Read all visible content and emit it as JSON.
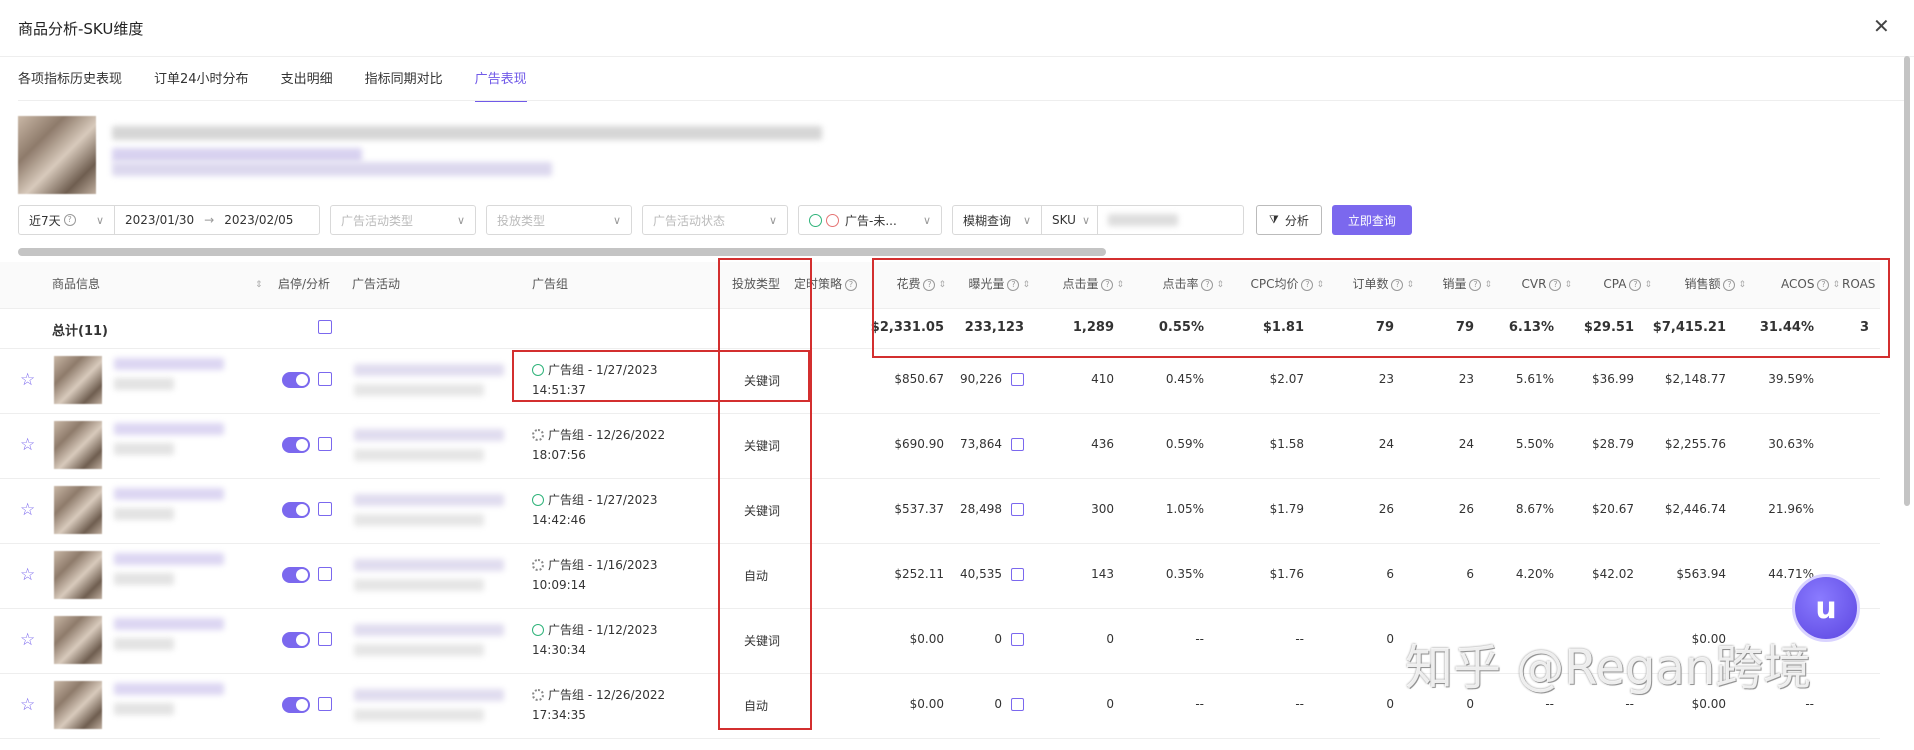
{
  "window": {
    "title": "商品分析-SKU维度",
    "close": "✕"
  },
  "tabs": [
    {
      "label": "各项指标历史表现"
    },
    {
      "label": "订单24小时分布"
    },
    {
      "label": "支出明细"
    },
    {
      "label": "指标同期对比"
    },
    {
      "label": "广告表现",
      "active": true
    }
  ],
  "filters": {
    "range_label": "近7天",
    "date_start": "2023/01/30",
    "date_arrow": "→",
    "date_end": "2023/02/05",
    "campaign_type_placeholder": "广告活动类型",
    "targeting_type_placeholder": "投放类型",
    "campaign_status_placeholder": "广告活动状态",
    "ad_status_value": "广告-未...",
    "fuzzy_query": "模糊查询",
    "sku_label": "SKU",
    "analyze_button": "分析",
    "query_button": "立即查询"
  },
  "columns": {
    "product": "商品信息",
    "toggle": "启停/分析",
    "campaign": "广告活动",
    "adgroup": "广告组",
    "targeting": "投放类型",
    "strategy": "定时策略",
    "spend": "花费",
    "impressions": "曝光量",
    "clicks": "点击量",
    "ctr": "点击率",
    "cpc": "CPC均价",
    "orders": "订单数",
    "units": "销量",
    "cvr": "CVR",
    "cpa": "CPA",
    "sales": "销售额",
    "acos": "ACOS",
    "roas": "ROAS"
  },
  "total": {
    "label": "总计(11)",
    "spend": "$2,331.05",
    "impressions": "233,123",
    "clicks": "1,289",
    "ctr": "0.55%",
    "cpc": "$1.81",
    "orders": "79",
    "units": "79",
    "cvr": "6.13%",
    "cpa": "$29.51",
    "sales": "$7,415.21",
    "acos": "31.44%",
    "roas": "3"
  },
  "rows": [
    {
      "adgroup_status": "running",
      "adgroup_line1": "广告组 - 1/27/2023",
      "adgroup_line2": "14:51:37",
      "targeting": "关键词",
      "spend": "$850.67",
      "impressions": "90,226",
      "clicks": "410",
      "ctr": "0.45%",
      "cpc": "$2.07",
      "orders": "23",
      "units": "23",
      "cvr": "5.61%",
      "cpa": "$36.99",
      "sales": "$2,148.77",
      "acos": "39.59%"
    },
    {
      "adgroup_status": "paused",
      "adgroup_line1": "广告组 - 12/26/2022",
      "adgroup_line2": "18:07:56",
      "targeting": "关键词",
      "spend": "$690.90",
      "impressions": "73,864",
      "clicks": "436",
      "ctr": "0.59%",
      "cpc": "$1.58",
      "orders": "24",
      "units": "24",
      "cvr": "5.50%",
      "cpa": "$28.79",
      "sales": "$2,255.76",
      "acos": "30.63%"
    },
    {
      "adgroup_status": "running",
      "adgroup_line1": "广告组 - 1/27/2023",
      "adgroup_line2": "14:42:46",
      "targeting": "关键词",
      "spend": "$537.37",
      "impressions": "28,498",
      "clicks": "300",
      "ctr": "1.05%",
      "cpc": "$1.79",
      "orders": "26",
      "units": "26",
      "cvr": "8.67%",
      "cpa": "$20.67",
      "sales": "$2,446.74",
      "acos": "21.96%"
    },
    {
      "adgroup_status": "paused",
      "adgroup_line1": "广告组 - 1/16/2023",
      "adgroup_line2": "10:09:14",
      "targeting": "自动",
      "spend": "$252.11",
      "impressions": "40,535",
      "clicks": "143",
      "ctr": "0.35%",
      "cpc": "$1.76",
      "orders": "6",
      "units": "6",
      "cvr": "4.20%",
      "cpa": "$42.02",
      "sales": "$563.94",
      "acos": "44.71%"
    },
    {
      "adgroup_status": "running",
      "adgroup_line1": "广告组 - 1/12/2023",
      "adgroup_line2": "14:30:34",
      "targeting": "关键词",
      "spend": "$0.00",
      "impressions": "0",
      "clicks": "0",
      "ctr": "--",
      "cpc": "--",
      "orders": "0",
      "units": "",
      "cvr": "",
      "cpa": "",
      "sales": "$0.00",
      "acos": ""
    },
    {
      "adgroup_status": "paused",
      "adgroup_line1": "广告组 - 12/26/2022",
      "adgroup_line2": "17:34:35",
      "targeting": "自动",
      "spend": "$0.00",
      "impressions": "0",
      "clicks": "0",
      "ctr": "--",
      "cpc": "--",
      "orders": "0",
      "units": "0",
      "cvr": "--",
      "cpa": "--",
      "sales": "$0.00",
      "acos": "--"
    }
  ],
  "watermark": "知乎 @Regan跨境",
  "colors": {
    "accent": "#7b68ee",
    "highlight": "#d32f2f",
    "running": "#2fb37a"
  },
  "icons": {
    "close": "close-icon",
    "star": "star-icon",
    "chart": "chart-icon",
    "help": "help-icon",
    "filter": "filter-icon"
  }
}
